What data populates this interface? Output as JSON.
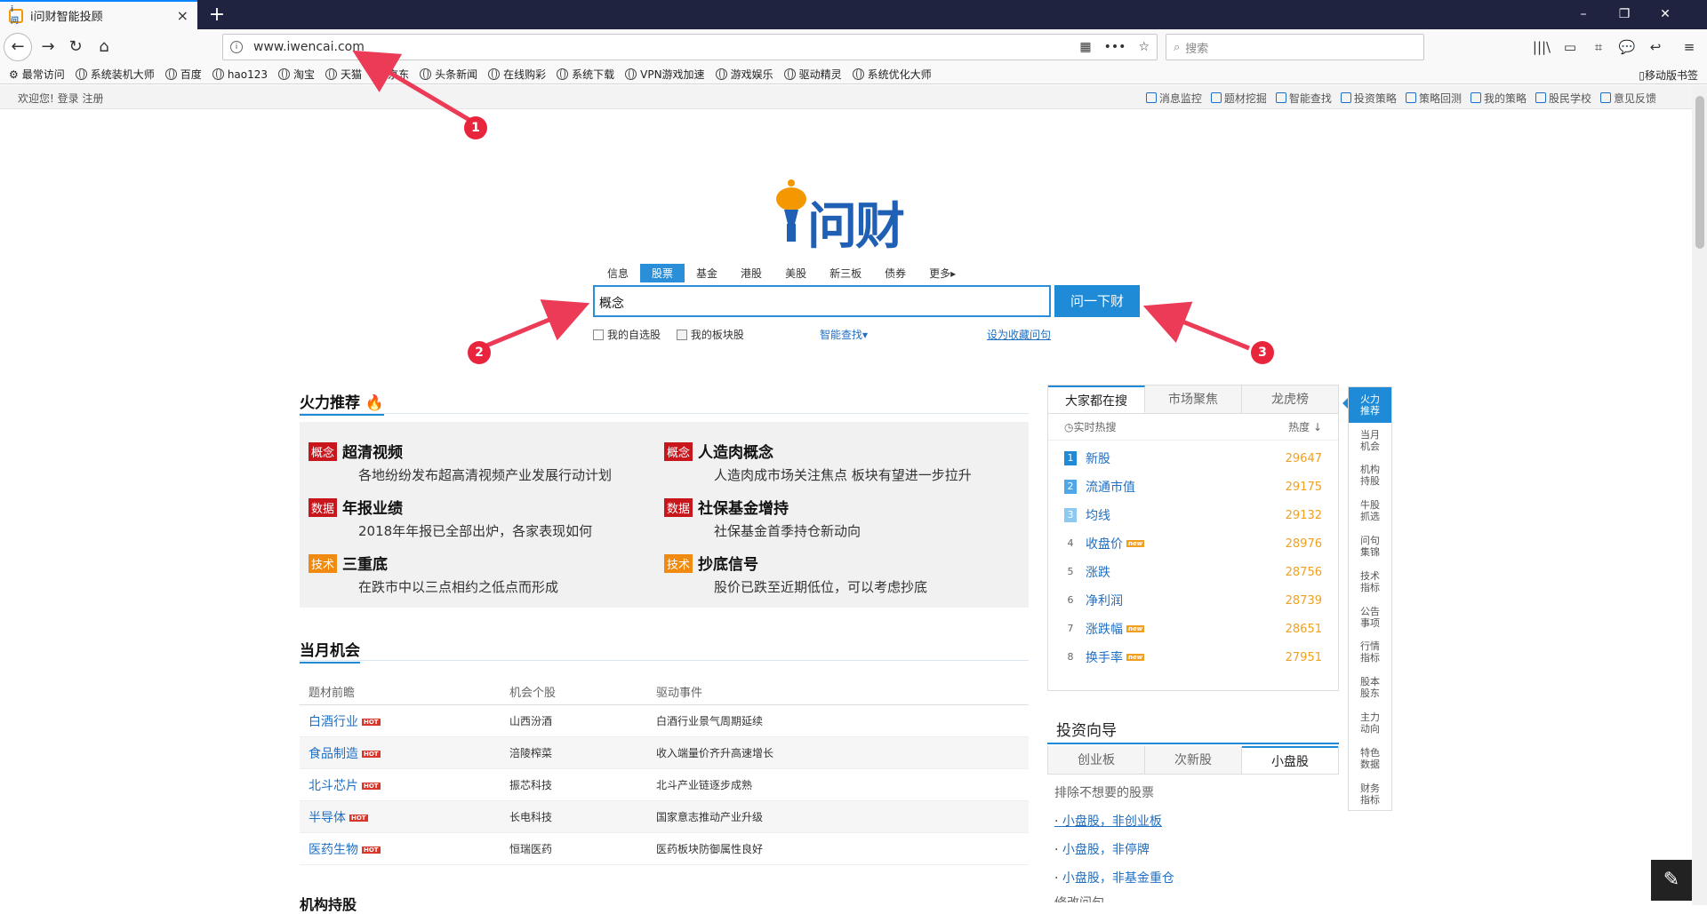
{
  "browser": {
    "tab_title": "i问财智能投顾",
    "tab_favicon": "i问",
    "tab_close": "×",
    "new_tab": "+",
    "url": "www.iwencai.com",
    "search_placeholder": "搜索",
    "window_controls": [
      "–",
      "❐",
      "✕"
    ],
    "nav_back": "←",
    "nav_forward": "→",
    "nav_reload": "↻",
    "nav_home": "⌂",
    "url_tools": [
      "▦",
      "•••",
      "☆"
    ],
    "right_tools": [
      "|||\\",
      "▭",
      "⌗",
      "💬",
      "↩",
      "≡"
    ],
    "bookmarks": [
      "最常访问",
      "系统装机大师",
      "百度",
      "hao123",
      "淘宝",
      "天猫",
      "京东",
      "头条新闻",
      "在线购彩",
      "系统下载",
      "VPN游戏加速",
      "游戏娱乐",
      "驱动精灵",
      "系统优化大师"
    ],
    "mobile_bookmarks": "移动版书签"
  },
  "topstrip": {
    "welcome": "欢迎您!  登录  注册",
    "links": [
      "消息监控",
      "题材挖掘",
      "智能查找",
      "投资策略",
      "策略回测",
      "我的策略",
      "股民学校",
      "意见反馈"
    ]
  },
  "logo": {
    "text": "问财"
  },
  "search": {
    "tabs": [
      "信息",
      "股票",
      "基金",
      "港股",
      "美股",
      "新三板",
      "债券",
      "更多▸"
    ],
    "active_tab": "股票",
    "input_value": "概念",
    "button": "问一下财",
    "opt_self": "我的自选股",
    "opt_block": "我的板块股",
    "smart": "智能查找▾",
    "favorite": "设为收藏问句"
  },
  "fire": {
    "title": "火力推荐",
    "items": [
      {
        "tag": "概念",
        "tag_color": "#c9161d",
        "title": "超清视频",
        "desc": "各地纷纷发布超高清视频产业发展行动计划"
      },
      {
        "tag": "概念",
        "tag_color": "#c9161d",
        "title": "人造肉概念",
        "desc": "人造肉成市场关注焦点 板块有望进一步拉升"
      },
      {
        "tag": "数据",
        "tag_color": "#c9161d",
        "title": "年报业绩",
        "desc": "2018年年报已全部出炉，各家表现如何"
      },
      {
        "tag": "数据",
        "tag_color": "#c9161d",
        "title": "社保基金增持",
        "desc": "社保基金首季持仓新动向"
      },
      {
        "tag": "技术",
        "tag_color": "#f08a10",
        "title": "三重底",
        "desc": "在跌市中以三点相约之低点而形成"
      },
      {
        "tag": "技术",
        "tag_color": "#f08a10",
        "title": "抄底信号",
        "desc": "股价已跌至近期低位，可以考虑抄底"
      }
    ]
  },
  "month": {
    "title": "当月机会",
    "headers": [
      "题材前瞻",
      "机会个股",
      "驱动事件"
    ],
    "hot_label": "HOT",
    "rows": [
      {
        "topic": "白酒行业",
        "stock": "山西汾酒",
        "event": "白酒行业景气周期延续"
      },
      {
        "topic": "食品制造",
        "stock": "涪陵榨菜",
        "event": "收入端量价齐升高速增长"
      },
      {
        "topic": "北斗芯片",
        "stock": "振芯科技",
        "event": "北斗产业链逐步成熟"
      },
      {
        "topic": "半导体",
        "stock": "长电科技",
        "event": "国家意志推动产业升级"
      },
      {
        "topic": "医药生物",
        "stock": "恒瑞医药",
        "event": "医药板块防御属性良好"
      }
    ]
  },
  "next_section": "机构持股",
  "hotsearch": {
    "tabs": [
      "大家都在搜",
      "市场聚焦",
      "龙虎榜"
    ],
    "sub_left": "实时热搜",
    "sub_right": "热度 ↓",
    "new_label": "new",
    "rows": [
      {
        "rank": "1",
        "name": "新股",
        "heat": "29647",
        "new": false
      },
      {
        "rank": "2",
        "name": "流通市值",
        "heat": "29175",
        "new": false
      },
      {
        "rank": "3",
        "name": "均线",
        "heat": "29132",
        "new": false
      },
      {
        "rank": "4",
        "name": "收盘价",
        "heat": "28976",
        "new": true
      },
      {
        "rank": "5",
        "name": "涨跌",
        "heat": "28756",
        "new": false
      },
      {
        "rank": "6",
        "name": "净利润",
        "heat": "28739",
        "new": false
      },
      {
        "rank": "7",
        "name": "涨跌幅",
        "heat": "28651",
        "new": true
      },
      {
        "rank": "8",
        "name": "换手率",
        "heat": "27951",
        "new": true
      }
    ]
  },
  "invest": {
    "title": "投资向导",
    "tabs": [
      "创业板",
      "次新股",
      "小盘股"
    ],
    "intro": "排除不想要的股票",
    "links": [
      "小盘股，非创业板",
      "小盘股，非停牌",
      "小盘股，非基金重仓"
    ],
    "cut": "修改问句"
  },
  "sidenav": [
    "火力推荐",
    "当月机会",
    "机构持股",
    "牛股抓选",
    "问句集锦",
    "技术指标",
    "公告事项",
    "行情指标",
    "股本股东",
    "主力动向",
    "特色数据",
    "财务指标"
  ],
  "edit_icon": "✎",
  "callouts": [
    "1",
    "2",
    "3"
  ],
  "colors": {
    "accent": "#1f8bd6",
    "hot": "#d8362a",
    "heat": "#f0a020",
    "callout": "#e8253c"
  }
}
